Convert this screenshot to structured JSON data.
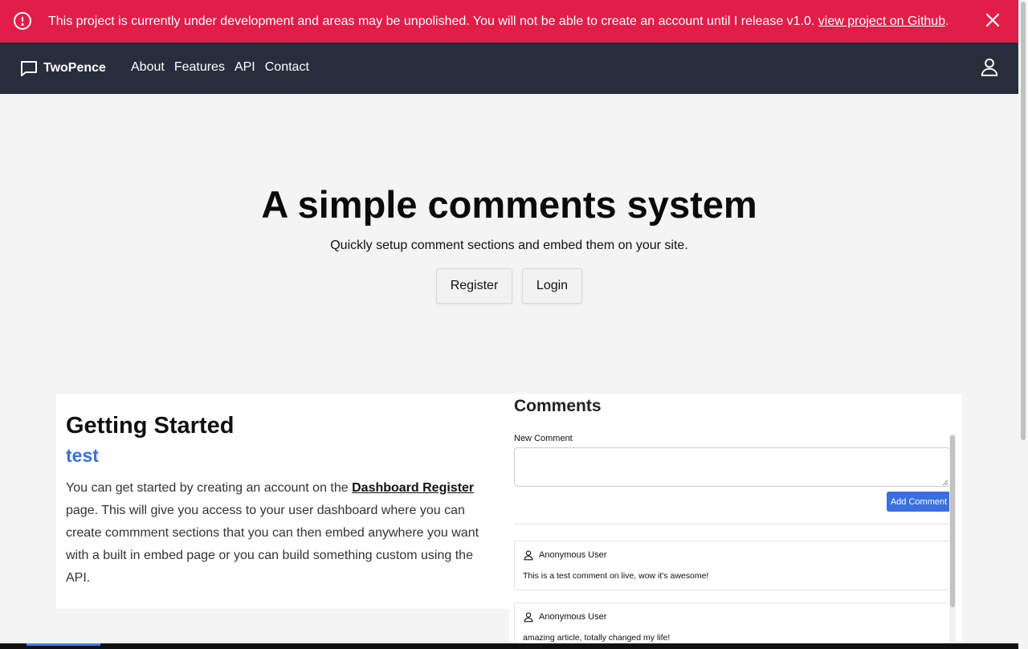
{
  "banner": {
    "message": "This project is currently under development and areas may be unpolished. You will not be able to create an account until I release v1.0. ",
    "link_text": "view project on Github",
    "trailing": ".",
    "icon": "alert-circle-icon",
    "close_icon": "close-icon",
    "color": "#e11d48"
  },
  "navbar": {
    "brand": "TwoPence",
    "brand_icon": "chat-bubble-icon",
    "links": [
      "About",
      "Features",
      "API",
      "Contact"
    ],
    "user_icon": "user-icon",
    "color": "#282d3c"
  },
  "hero": {
    "title": "A simple comments system",
    "subtitle": "Quickly setup comment sections and embed them on your site.",
    "register_label": "Register",
    "login_label": "Login"
  },
  "getting_started": {
    "heading": "Getting Started",
    "tag": "test",
    "text_before": "You can get started by creating an account on the ",
    "link_text": "Dashboard Register",
    "text_after": " page. This will give you access to your user dashboard where you can create commment sections that you can then embed anywhere you want with a built in embed page or you can build something custom using the API."
  },
  "comments": {
    "heading": "Comments",
    "new_comment_label": "New Comment",
    "add_button": "Add Comment",
    "accent": "#3b6fe0",
    "items": [
      {
        "author": "Anonymous User",
        "body": "This is a test comment on live, wow it's awesome!"
      },
      {
        "author": "Anonymous User",
        "body": "amazing article, totally changed my life!"
      }
    ]
  }
}
